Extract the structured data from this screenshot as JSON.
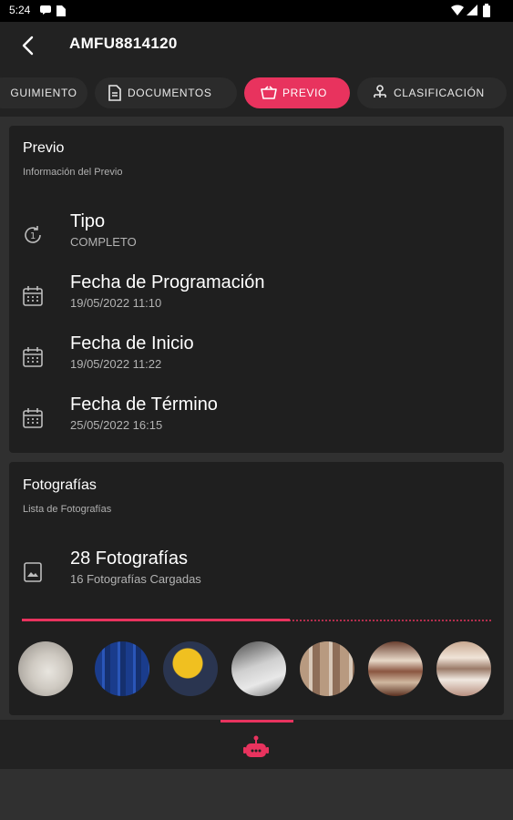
{
  "status_bar": {
    "time": "5:24"
  },
  "header": {
    "title": "AMFU8814120"
  },
  "tabs": [
    {
      "label": "GUIMIENTO",
      "icon": "tracking-icon",
      "active": false
    },
    {
      "label": "DOCUMENTOS",
      "icon": "document-icon",
      "active": false
    },
    {
      "label": "PREVIO",
      "icon": "basket-icon",
      "active": true
    },
    {
      "label": "CLASIFICACIÓN",
      "icon": "hierarchy-icon",
      "active": false
    }
  ],
  "previo": {
    "title": "Previo",
    "subtitle": "Información del Previo",
    "rows": [
      {
        "icon": "one-circle-icon",
        "label": "Tipo",
        "value": "COMPLETO"
      },
      {
        "icon": "calendar-icon",
        "label": "Fecha de Programación",
        "value": "19/05/2022 11:10"
      },
      {
        "icon": "calendar-icon",
        "label": "Fecha de Inicio",
        "value": "19/05/2022 11:22"
      },
      {
        "icon": "calendar-icon",
        "label": "Fecha de Término",
        "value": "25/05/2022 16:15"
      }
    ]
  },
  "fotografias": {
    "title": "Fotografías",
    "subtitle": "Lista de Fotografías",
    "count_label": "28 Fotografías",
    "uploaded_label": "16 Fotografías Cargadas",
    "progress": 0.57,
    "thumbnails": [
      "photo-1",
      "photo-2",
      "photo-3",
      "photo-4",
      "photo-5",
      "photo-6",
      "photo-7"
    ]
  },
  "colors": {
    "accent": "#e8335e",
    "card": "#1f1f1f",
    "bar": "#222222",
    "background": "#303030"
  }
}
